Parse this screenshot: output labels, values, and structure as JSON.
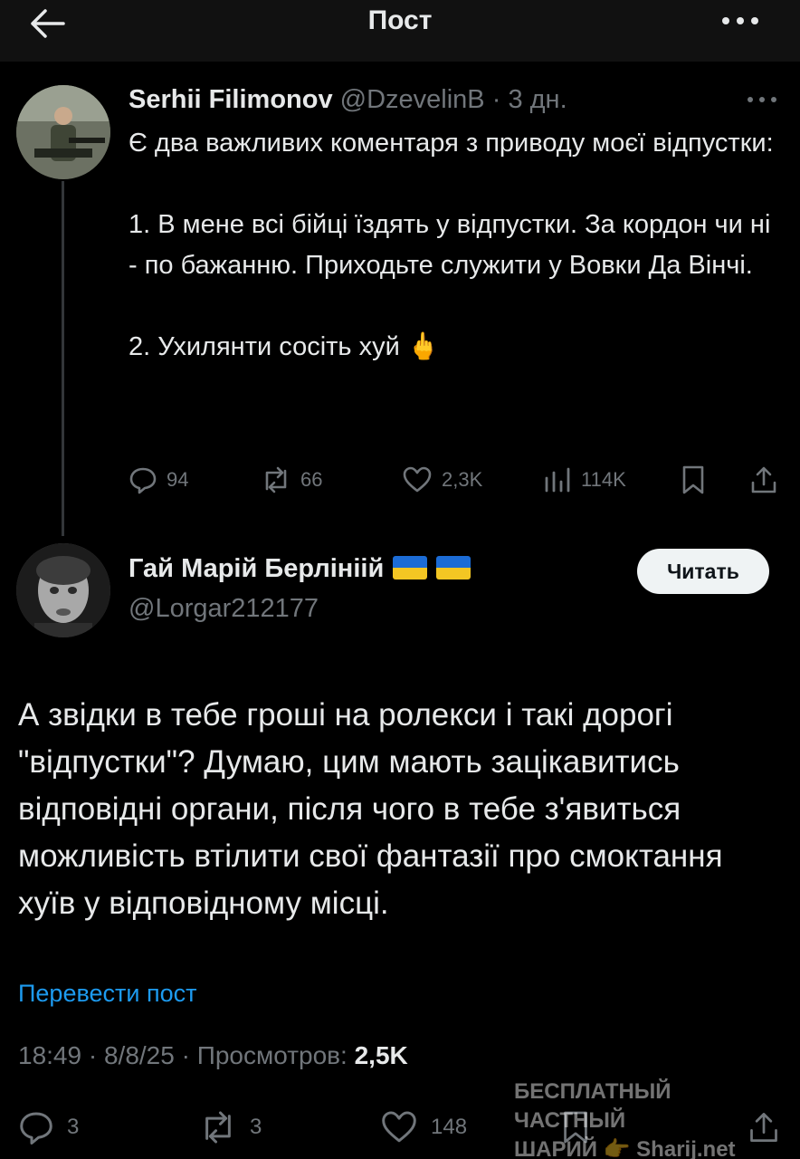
{
  "header": {
    "title": "Пост"
  },
  "quoted_post": {
    "author_name": "Serhii Filimonov",
    "handle": "@DzevelinB",
    "separator": "·",
    "time": "3 дн.",
    "text": "Є два важливих коментаря з приводу моєї відпустки:\n\n1. В мене всі бійці їздять у відпустки. За кордон чи ні - по бажанню. Приходьте служити у Вовки Да Вінчі.\n\n2. Ухилянти сосіть хуй 🖕",
    "stats": {
      "replies": "94",
      "reposts": "66",
      "likes": "2,3K",
      "views": "114K"
    }
  },
  "main_post": {
    "author_name": "Гай Марій Берлініій",
    "handle": "@Lorgar212177",
    "follow_label": "Читать",
    "text": "А звідки в тебе гроші на ролекси і такі дорогі \"відпустки\"? Думаю, цим мають зацікавитись відповідні органи, після чого в тебе з'явиться можливість втілити свої фантазії про смоктання хуїв у відповідному місці.",
    "translate_label": "Перевести пост",
    "time": "18:49",
    "date": "8/8/25",
    "views_label": "Просмотров:",
    "views_value": "2,5K",
    "stats": {
      "replies": "3",
      "reposts": "3",
      "likes": "148"
    }
  },
  "watermark": {
    "line1": "БЕСПЛАТНЫЙ ЧАСТНЫЙ",
    "line2": "ШАРИЙ 👉 Sharij.net"
  },
  "colors": {
    "background": "#000000",
    "text": "#e7e9ea",
    "muted": "#71767b",
    "link": "#1d9bf0"
  }
}
